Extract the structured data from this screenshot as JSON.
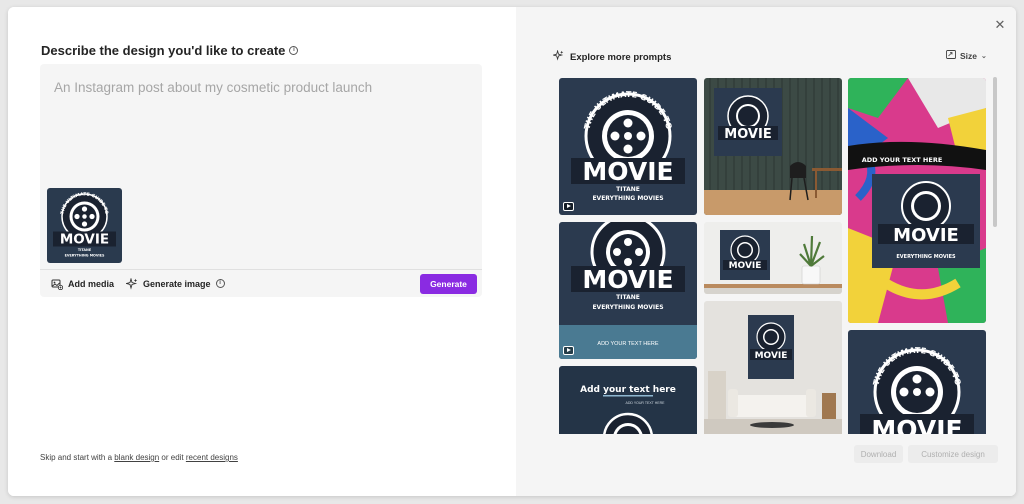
{
  "left": {
    "title": "Describe the design you'd like to create",
    "prompt_placeholder": "An Instagram post about my cosmetic product launch",
    "toolbar": {
      "add_media_label": "Add media",
      "generate_image_label": "Generate image",
      "generate_button": "Generate"
    },
    "footer": {
      "prefix": "Skip and start with a ",
      "blank_link": "blank design",
      "middle": " or edit ",
      "recent_link": "recent designs"
    }
  },
  "right": {
    "explore_label": "Explore more prompts",
    "size_label": "Size",
    "download_button": "Download",
    "customize_button": "Customize design"
  },
  "logo": {
    "arc_text": "THE ULTIMATE GUIDE TO",
    "main_word": "MOVIE",
    "sub_word": "TITANE",
    "bottom_text": "EVERYTHING MOVIES"
  },
  "tiles": {
    "add_text_small": "ADD YOUR TEXT HERE",
    "add_text_large": "Add your text here",
    "add_text_sub": "ADD YOUR TEXT HERE"
  },
  "colors": {
    "accent": "#8a2be2",
    "logo_bg": "#1e2a3a",
    "logo_teal": "#4a7a92"
  }
}
